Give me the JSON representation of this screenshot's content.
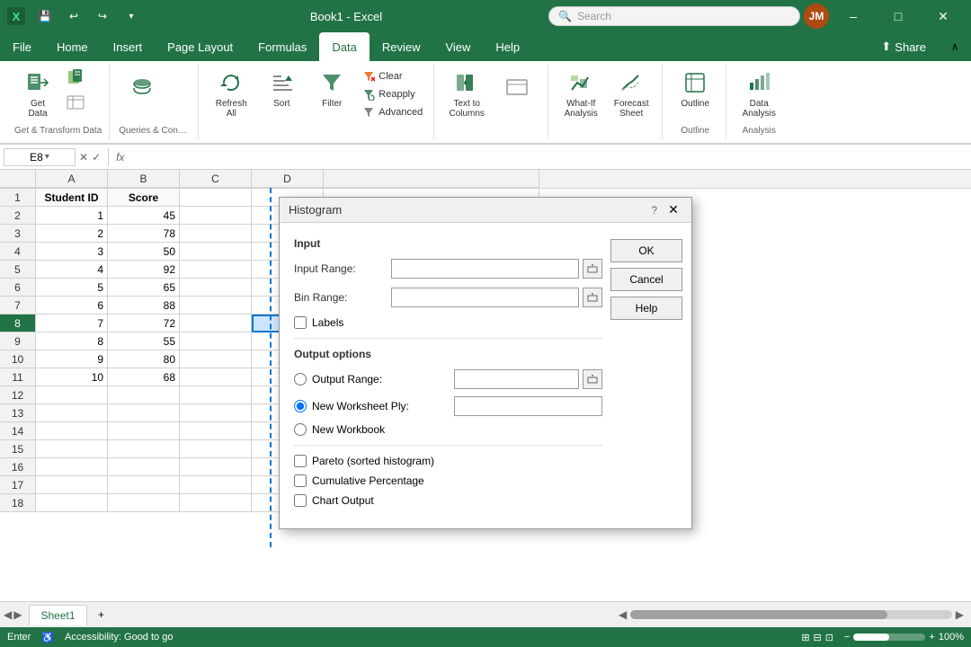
{
  "app": {
    "title": "Book1 - Excel",
    "icon": "X"
  },
  "titlebar": {
    "undo": "↩",
    "redo": "↪",
    "save": "💾",
    "minimize": "–",
    "maximize": "□",
    "close": "✕"
  },
  "search": {
    "placeholder": "Search"
  },
  "ribbon": {
    "tabs": [
      "File",
      "Home",
      "Insert",
      "Page Layout",
      "Formulas",
      "Data",
      "Review",
      "View",
      "Help"
    ],
    "active_tab": "Data",
    "groups": {
      "get_transform": {
        "label": "Get & Transform Data",
        "buttons": [
          {
            "label": "Get Data",
            "icon": "📥"
          },
          {
            "label": "",
            "icon": ""
          }
        ]
      },
      "queries": {
        "label": "Queries & Connec...",
        "buttons": [
          {
            "label": "",
            "icon": ""
          }
        ]
      },
      "sort_filter": {
        "label": "",
        "refresh_label": "Refresh All",
        "sort_label": "Sort",
        "filter_label": "Filter",
        "clear_label": "Clear",
        "reapply_label": "Reapply",
        "advanced_label": "Advanced"
      },
      "data_tools": {
        "label": "",
        "text_to_cols": "Text to Columns"
      },
      "forecast": {
        "label": "",
        "what_if": "What-If Analysis",
        "forecast_sheet": "Forecast Sheet"
      },
      "outline": {
        "label": "Outline"
      },
      "analysis": {
        "label": "Analysis",
        "data_analysis": "Data Analysis"
      }
    },
    "share_label": "Share",
    "collapse_icon": "∧"
  },
  "formula_bar": {
    "cell_ref": "E8",
    "fx": "fx",
    "formula": ""
  },
  "columns": [
    "A",
    "B",
    "C",
    "D"
  ],
  "rows": [
    {
      "id": 1,
      "label": "1",
      "cells": [
        "Student ID",
        "Score",
        "",
        ""
      ]
    },
    {
      "id": 2,
      "label": "2",
      "cells": [
        "1",
        "45",
        "",
        ""
      ]
    },
    {
      "id": 3,
      "label": "3",
      "cells": [
        "2",
        "78",
        "",
        ""
      ]
    },
    {
      "id": 4,
      "label": "4",
      "cells": [
        "3",
        "50",
        "",
        ""
      ]
    },
    {
      "id": 5,
      "label": "5",
      "cells": [
        "4",
        "92",
        "",
        ""
      ]
    },
    {
      "id": 6,
      "label": "6",
      "cells": [
        "5",
        "65",
        "",
        ""
      ]
    },
    {
      "id": 7,
      "label": "7",
      "cells": [
        "6",
        "88",
        "",
        ""
      ]
    },
    {
      "id": 8,
      "label": "8",
      "cells": [
        "7",
        "72",
        "",
        ""
      ]
    },
    {
      "id": 9,
      "label": "9",
      "cells": [
        "8",
        "55",
        "",
        ""
      ]
    },
    {
      "id": 10,
      "label": "10",
      "cells": [
        "9",
        "80",
        "",
        ""
      ]
    },
    {
      "id": 11,
      "label": "11",
      "cells": [
        "10",
        "68",
        "",
        ""
      ]
    },
    {
      "id": 12,
      "label": "12",
      "cells": [
        "",
        "",
        "",
        ""
      ]
    },
    {
      "id": 13,
      "label": "13",
      "cells": [
        "",
        "",
        "",
        ""
      ]
    },
    {
      "id": 14,
      "label": "14",
      "cells": [
        "",
        "",
        "",
        ""
      ]
    },
    {
      "id": 15,
      "label": "15",
      "cells": [
        "",
        "",
        "",
        ""
      ]
    },
    {
      "id": 16,
      "label": "16",
      "cells": [
        "",
        "",
        "",
        ""
      ]
    },
    {
      "id": 17,
      "label": "17",
      "cells": [
        "",
        "",
        "",
        ""
      ]
    },
    {
      "id": 18,
      "label": "18",
      "cells": [
        "",
        "",
        "",
        ""
      ]
    }
  ],
  "dialog": {
    "title": "Histogram",
    "help_icon": "?",
    "close_icon": "✕",
    "input_section": "Input",
    "input_range_label": "Input Range:",
    "bin_range_label": "Bin Range:",
    "labels_label": "Labels",
    "output_section": "Output options",
    "output_range_label": "Output Range:",
    "new_worksheet_label": "New Worksheet Ply:",
    "new_workbook_label": "New Workbook",
    "pareto_label": "Pareto (sorted histogram)",
    "cumulative_label": "Cumulative Percentage",
    "chart_label": "Chart Output",
    "ok_label": "OK",
    "cancel_label": "Cancel",
    "help_label": "Help",
    "new_worksheet_value": ""
  },
  "sheet_tabs": [
    {
      "label": "Sheet1",
      "active": true
    }
  ],
  "status_bar": {
    "left": "Enter",
    "accessibility": "Accessibility: Good to go",
    "view_icons": [
      "normal",
      "page-layout",
      "page-break"
    ],
    "zoom": "100%"
  }
}
